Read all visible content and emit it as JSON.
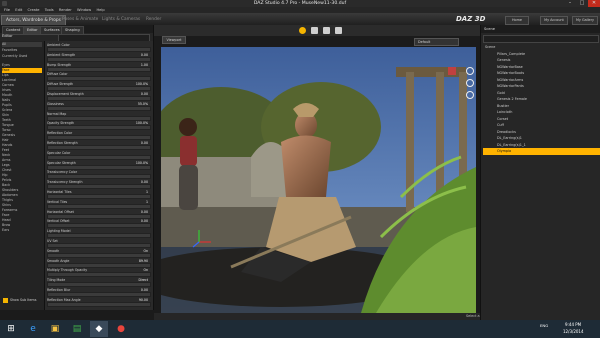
{
  "window": {
    "title": "DAZ Studio 4.7 Pro - MuseNew11-30.duf",
    "minimize_glyph": "–",
    "maximize_glyph": "□",
    "close_glyph": "✕"
  },
  "menu": [
    "File",
    "Edit",
    "Create",
    "Tools",
    "Render",
    "Window",
    "Help"
  ],
  "tabs": [
    "Actors, Wardrobe & Props",
    "Poses & Animate",
    "Lights & Cameras",
    "Render"
  ],
  "logo": "DAZ 3D",
  "top_buttons": [
    "Home",
    "My Account",
    "My Gallery"
  ],
  "left_panel": {
    "tabs": [
      "Content",
      "Editor",
      "Surfaces",
      "Shaping"
    ],
    "header": "Editor",
    "side_categories": [
      "All",
      "Favorites",
      "Currently Used"
    ],
    "tree_items": [
      "Eyes",
      "Face",
      "Lips",
      "Lacrimal",
      "Cornea",
      "Irises",
      "Mouth",
      "Nails",
      "Pupils",
      "Sclera",
      "Skin",
      "Teeth",
      "Tongue",
      "Torso",
      "Genesis",
      "Hair",
      "Hands",
      "Feet",
      "Neck",
      "Arms",
      "Legs",
      "Chest",
      "Hip",
      "Pelvis",
      "Back",
      "Shoulders",
      "Abdomen",
      "Thighs",
      "Shins",
      "Forearms",
      "Face",
      "Head",
      "Brow",
      "Ears"
    ],
    "selected_tree_item": "Face",
    "bottom_check": "Show Sub Items",
    "properties": [
      {
        "label": "Ambient Color",
        "value": ""
      },
      {
        "label": "Ambient Strength",
        "value": "0.00"
      },
      {
        "label": "Bump Strength",
        "value": "1.00"
      },
      {
        "label": "Diffuse Color",
        "value": ""
      },
      {
        "label": "Diffuse Strength",
        "value": "100.0%"
      },
      {
        "label": "Displacement Strength",
        "value": "0.00"
      },
      {
        "label": "Glossiness",
        "value": "55.0%"
      },
      {
        "label": "Normal Map",
        "value": ""
      },
      {
        "label": "Opacity Strength",
        "value": "100.0%"
      },
      {
        "label": "Reflection Color",
        "value": ""
      },
      {
        "label": "Reflection Strength",
        "value": "0.00"
      },
      {
        "label": "Specular Color",
        "value": ""
      },
      {
        "label": "Specular Strength",
        "value": "100.0%"
      },
      {
        "label": "Translucency Color",
        "value": ""
      },
      {
        "label": "Translucency Strength",
        "value": "0.00"
      },
      {
        "label": "Horizontal Tiles",
        "value": "1"
      },
      {
        "label": "Vertical Tiles",
        "value": "1"
      },
      {
        "label": "Horizontal Offset",
        "value": "0.00"
      },
      {
        "label": "Vertical Offset",
        "value": "0.00"
      },
      {
        "label": "Lighting Model",
        "value": ""
      },
      {
        "label": "UV Set",
        "value": ""
      },
      {
        "label": "Smooth",
        "value": "On"
      },
      {
        "label": "Smooth Angle",
        "value": "89.90"
      },
      {
        "label": "Multiply Through Opacity",
        "value": "On"
      },
      {
        "label": "Tiling Mode",
        "value": "Direct"
      },
      {
        "label": "Reflection Blur",
        "value": "0.00"
      },
      {
        "label": "Reflection Max Angle",
        "value": "90.00"
      }
    ]
  },
  "viewport": {
    "tab": "Viewport",
    "camera": "Default",
    "status": "Select a Location"
  },
  "right_panel": {
    "header": "Scene",
    "items": [
      "Scene",
      "Pillars_Complete",
      "Genesis",
      "NGWarriorBase",
      "NGWarriorBoots",
      "NGWarriorArms",
      "NGWarriorPants",
      "Gold",
      "Genesis 2 Female",
      "Bustier",
      "Loincloth",
      "Corset",
      "Cuff",
      "Dreadlocks",
      "DL_Earring(s)1",
      "DL_Earring(s)1_1",
      "Olympia"
    ],
    "selected": "Olympia"
  },
  "taskbar": {
    "time": "9:44 PM",
    "date": "12/3/2014",
    "lang": "ENG"
  },
  "colors": {
    "selection": "#ffb300",
    "accent": "#f4b400",
    "close": "#c42b1c"
  }
}
